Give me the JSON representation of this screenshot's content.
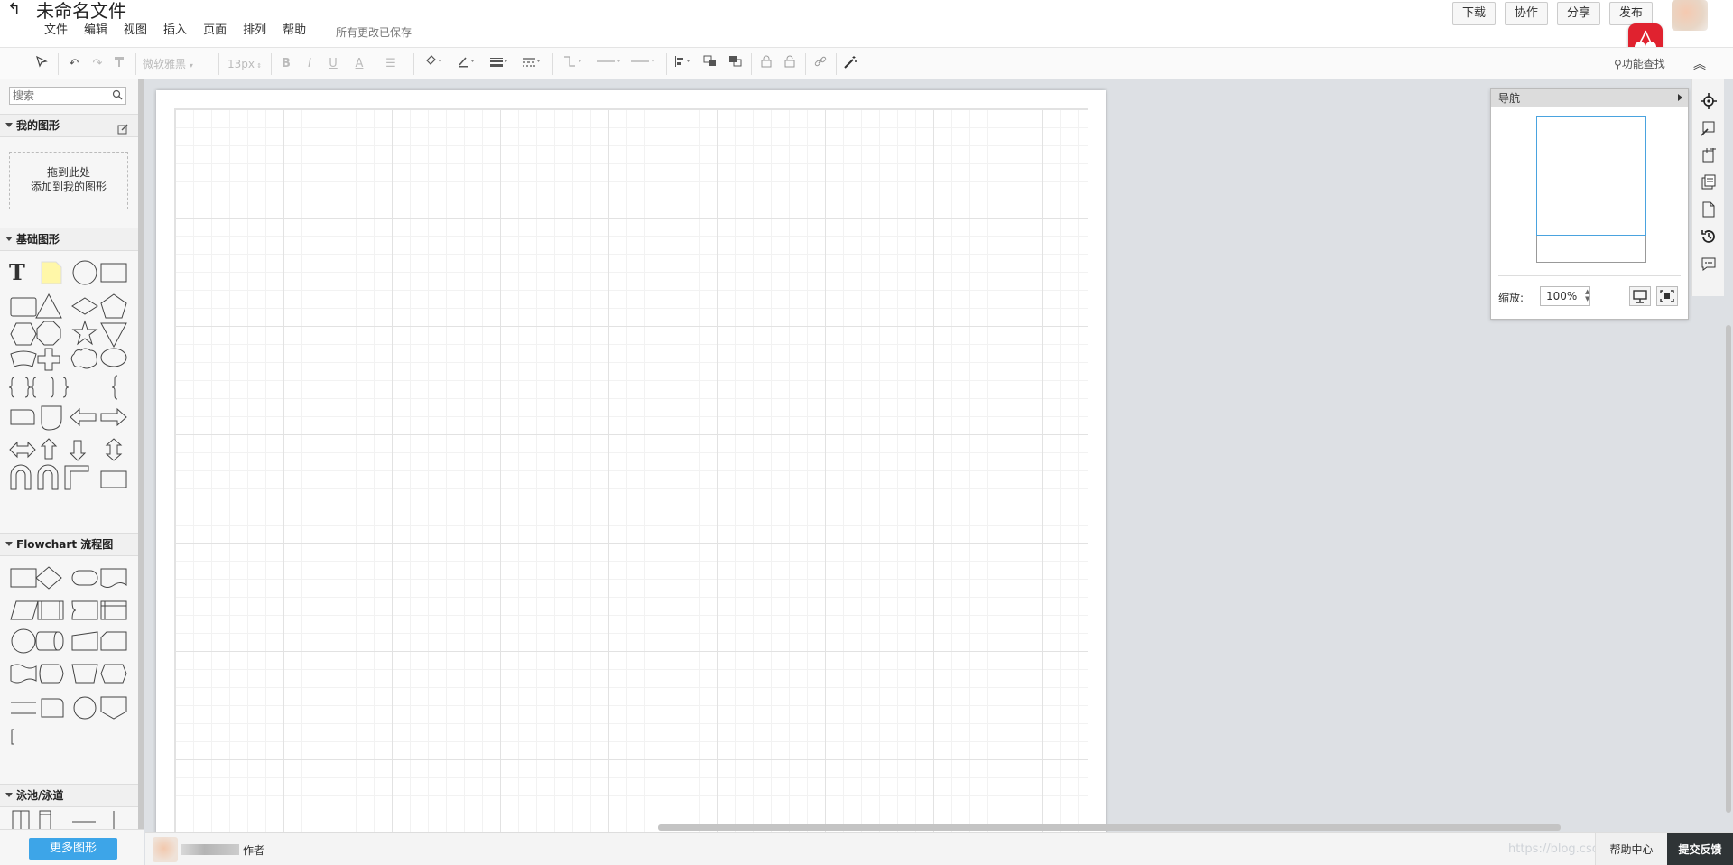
{
  "header": {
    "back_icon": "arrow-left-icon",
    "title": "未命名文件",
    "menus": [
      "文件",
      "编辑",
      "视图",
      "插入",
      "页面",
      "排列",
      "帮助"
    ],
    "save_status": "所有更改已保存",
    "buttons": {
      "download": "下载",
      "collaborate": "协作",
      "share": "分享",
      "publish": "发布"
    }
  },
  "toolbar": {
    "font_family": "微软雅黑",
    "font_size": "13px",
    "bold": "B",
    "italic": "I",
    "underline": "U",
    "font_color": "A",
    "function_search": "功能查找"
  },
  "sidebar": {
    "search_placeholder": "搜索",
    "sections": {
      "my_shapes": "我的图形",
      "basic_shapes": "基础图形",
      "flowchart": "Flowchart 流程图",
      "swimlane": "泳池/泳道"
    },
    "drop_zone_line1": "拖到此处",
    "drop_zone_line2": "添加到我的图形",
    "more_shapes": "更多图形"
  },
  "navigator": {
    "title": "导航",
    "zoom_label": "缩放:",
    "zoom_value": "100%"
  },
  "footer": {
    "author_suffix": "作者",
    "watermark": "https://blog.csdn.net/...",
    "help_center": "帮助中心",
    "feedback": "提交反馈"
  },
  "colors": {
    "accent": "#3da5e8",
    "publish_badge": "#e0222f",
    "feedback_bg": "#2f3436",
    "canvas_bg": "#dde0e4",
    "navigator_view": "#4aa3df"
  }
}
